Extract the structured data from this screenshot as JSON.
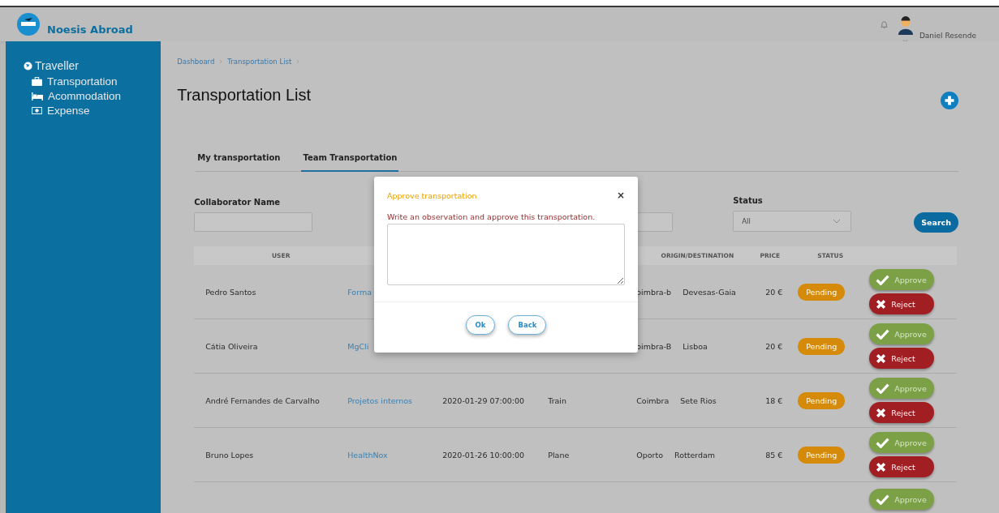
{
  "app": {
    "name": "Noesis Abroad"
  },
  "header": {
    "user_name": "Daniel Resende"
  },
  "sidebar": {
    "sections": [
      {
        "label": "Traveller",
        "children": [
          {
            "label": "Transportation"
          },
          {
            "label": "Acommodation"
          },
          {
            "label": "Expense"
          }
        ]
      }
    ]
  },
  "breadcrumb": [
    "Dashboard",
    "Transportation List"
  ],
  "page_title": "Transportation List",
  "tabs": [
    {
      "label": "My transportation",
      "selected": false
    },
    {
      "label": "Team Transportation",
      "selected": true
    }
  ],
  "filters": {
    "collaborator_label": "Collaborator Name",
    "status_label": "Status",
    "status_value": "All",
    "search_button": "Search"
  },
  "table": {
    "headers": {
      "user": "USER",
      "origin_destination": "ORIGIN/DESTINATION",
      "price": "PRICE",
      "status": "STATUS"
    },
    "rows": [
      {
        "user": "Pedro Santos",
        "project": "Forma",
        "origin": "oimbra-b",
        "destination": "Devesas-Gaia",
        "price": "20 €",
        "status": "Pending",
        "color": "#d68a0a",
        "actions": [
          {
            "kind": "approve",
            "label": "Approve"
          },
          {
            "kind": "reject",
            "label": "Reject"
          }
        ]
      },
      {
        "user": "Cátia Oliveira",
        "project": "MgCli",
        "origin": "oimbra-B",
        "destination": "Lisboa",
        "price": "20 €",
        "status": "Pending",
        "color": "#d68a0a",
        "actions": [
          {
            "kind": "approve",
            "label": "Approve"
          },
          {
            "kind": "reject",
            "label": "Reject"
          }
        ]
      },
      {
        "user": "André Fernandes de Carvalho",
        "project": "Projetos internos",
        "date": "2020-01-29 07:00:00",
        "transport": "Train",
        "origin": "Coimbra",
        "destination": "Sete Rios",
        "price": "18 €",
        "status": "Pending",
        "color": "#d68a0a",
        "actions": [
          {
            "kind": "approve",
            "label": "Approve"
          },
          {
            "kind": "reject",
            "label": "Reject"
          }
        ]
      },
      {
        "user": "Bruno Lopes",
        "project": "HealthNox",
        "date": "2020-01-26 10:00:00",
        "transport": "Plane",
        "origin": "Oporto",
        "destination": "Rotterdam",
        "price": "85 €",
        "status": "Pending",
        "color": "#d68a0a",
        "actions": [
          {
            "kind": "approve",
            "label": "Approve"
          },
          {
            "kind": "reject",
            "label": "Reject"
          }
        ]
      },
      {
        "actions": [
          {
            "kind": "approve",
            "label": "Approve"
          }
        ]
      }
    ]
  },
  "modal": {
    "title": "Approve transportation",
    "close": "×",
    "message": "Write an observation and approve this transportation.",
    "buttons": [
      "Ok",
      "Back"
    ]
  }
}
